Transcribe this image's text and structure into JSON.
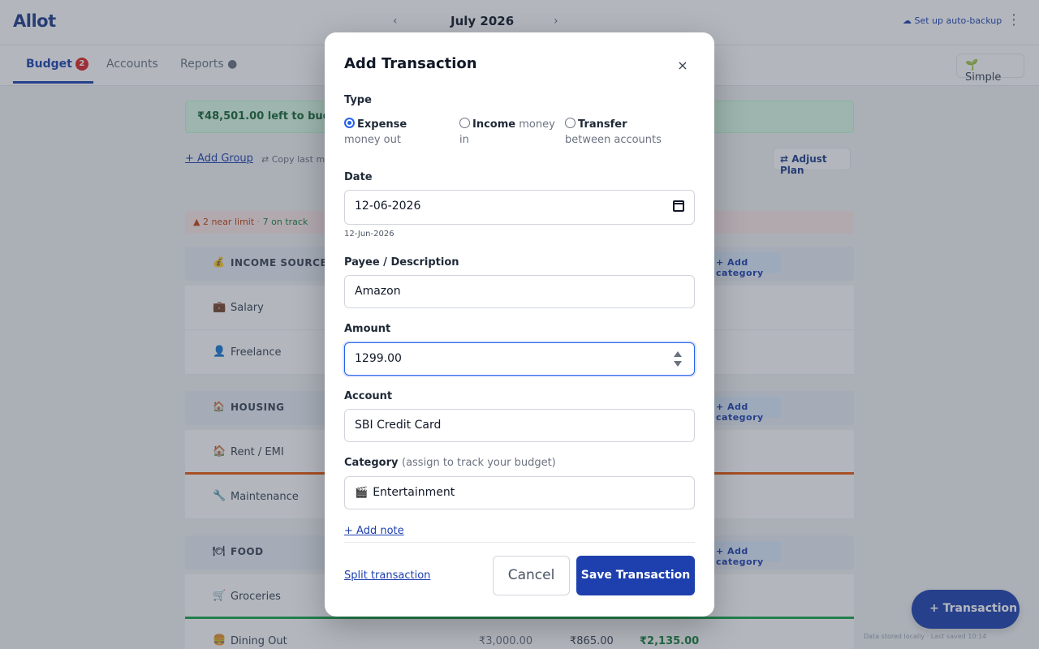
{
  "app": {
    "logo": "Allot",
    "month": "July 2026",
    "prev": "‹",
    "next": "›",
    "backup_label": "☁ Set up auto-backup",
    "menu": "⋮",
    "tabs": [
      {
        "label": "Budget",
        "badge": "2"
      },
      {
        "label": "Accounts"
      },
      {
        "label": "Reports ●"
      }
    ],
    "mode_label": "🌱 Simple",
    "banner": "₹48,501.00 left to budget",
    "add_group": "+ Add Group",
    "copy_last": "⇄ Copy last month",
    "adjust_plan": "⇄ Adjust Plan",
    "status_warn": "▲ 2 near limit",
    "status_ok": "7 on track",
    "groups": [
      {
        "icon": "💰",
        "name": "INCOME SOURCES",
        "add": "+ Add category",
        "rows": [
          {
            "icon": "💼",
            "name": "Salary"
          },
          {
            "icon": "👤",
            "name": "Freelance"
          }
        ]
      },
      {
        "icon": "🏠",
        "name": "HOUSING",
        "add": "+ Add category",
        "rows": [
          {
            "icon": "🏠",
            "name": "Rent / EMI"
          },
          {
            "icon": "🔧",
            "name": "Maintenance"
          }
        ]
      },
      {
        "icon": "🍽",
        "name": "FOOD",
        "add": "+ Add category",
        "rows": [
          {
            "icon": "🛒",
            "name": "Groceries"
          },
          {
            "icon": "🍔",
            "name": "Dining Out",
            "planned": "₹3,000.00",
            "spent": "₹865.00",
            "left": "₹2,135.00"
          }
        ]
      }
    ],
    "fab_label": "+ Transaction",
    "footer": "Data stored locally · Last saved 10:14"
  },
  "modal": {
    "title": "Add Transaction",
    "close": "×",
    "type_label": "Type",
    "types": [
      {
        "name": "Expense",
        "desc": "money out",
        "checked": true
      },
      {
        "name": "Income",
        "desc": "money in",
        "checked": false
      },
      {
        "name": "Transfer",
        "desc": "between accounts",
        "checked": false
      }
    ],
    "date_label": "Date",
    "date_value": "12-06-2026",
    "date_hint": "12-Jun-2026",
    "payee_label": "Payee / Description",
    "payee_value": "Amazon",
    "amount_label": "Amount",
    "amount_value": "1299.00",
    "account_label": "Account",
    "account_value": "SBI Credit Card",
    "category_label": "Category",
    "category_sub": "(assign to track your budget)",
    "category_icon": "🎬",
    "category_value": "Entertainment",
    "add_note": "+ Add note",
    "split": "Split transaction",
    "cancel": "Cancel",
    "save": "Save Transaction"
  },
  "colors": {
    "primary": "#1e40af",
    "focus": "#2563eb",
    "overlay": "rgba(55,65,81,0.38)"
  }
}
